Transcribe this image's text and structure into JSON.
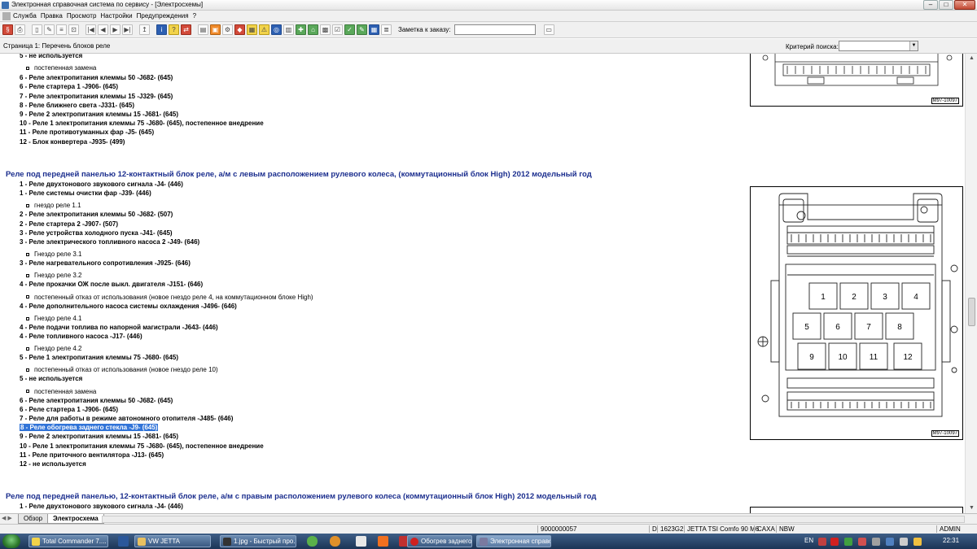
{
  "window": {
    "title": "Электронная справочная система по сервису - [Электросхемы]"
  },
  "menu": [
    "Служба",
    "Правка",
    "Просмотр",
    "Настройки",
    "Предупреждения",
    "?"
  ],
  "toolbar": {
    "note_label": "Заметка к заказу:"
  },
  "crumb": {
    "text": "Страница 1: Перечень блоков реле",
    "criteria_label": "Критерий поиска:"
  },
  "block1_lines": [
    {
      "t": "5 -  не используется",
      "kind": "b"
    },
    {
      "t": "постепенная замена",
      "kind": "sub"
    },
    {
      "t": "6 -  Реле электропитания клеммы 50 -J682- (645)",
      "kind": "b"
    },
    {
      "t": "6 -  Реле стартера 1 -J906- (645)",
      "kind": "b"
    },
    {
      "t": "7 -  Реле электропитания клеммы 15 -J329- (645)",
      "kind": "b"
    },
    {
      "t": "8 -  Реле ближнего света -J331- (645)",
      "kind": "b"
    },
    {
      "t": "9 -  Реле 2 электропитания клеммы 15 -J681- (645)",
      "kind": "b"
    },
    {
      "t": "10 -  Реле 1 электропитания клеммы 75 -J680- (645), постепенное внедрение",
      "kind": "b"
    },
    {
      "t": "11 -  Реле противотуманных фар -J5- (645)",
      "kind": "b"
    },
    {
      "t": "12 -  Блок конвертера -J935- (499)",
      "kind": "b"
    }
  ],
  "heading1": "Реле под передней панелью 12-контактный блок реле, а/м с левым расположением рулевого колеса, (коммутационный блок High) 2012 модельный год",
  "block2_lines": [
    {
      "t": "1 -  Реле двухтонового звукового сигнала -J4- (446)",
      "kind": "b"
    },
    {
      "t": "1 -  Реле системы очистки фар -J39- (446)",
      "kind": "b"
    },
    {
      "t": "гнездо реле 1.1",
      "kind": "sub"
    },
    {
      "t": "2 -  Реле электропитания клеммы 50 -J682- (507)",
      "kind": "b"
    },
    {
      "t": "2 -  Реле стартера 2 -J907- (507)",
      "kind": "b"
    },
    {
      "t": "3 -  Реле устройства холодного пуска -J41- (645)",
      "kind": "b"
    },
    {
      "t": "3 -  Реле электрического топливного насоса 2 -J49- (646)",
      "kind": "b"
    },
    {
      "t": "Гнездо реле 3.1",
      "kind": "sub"
    },
    {
      "t": "3 -  Реле нагревательного сопротивления -J925- (646)",
      "kind": "b"
    },
    {
      "t": "Гнездо реле 3.2",
      "kind": "sub"
    },
    {
      "t": "4 -  Реле прокачки ОЖ после выкл. двигателя -J151- (646)",
      "kind": "b"
    },
    {
      "t": "постепенный отказ от использования (новое гнездо реле 4, на коммутационном блоке High)",
      "kind": "sub"
    },
    {
      "t": "4 -  Реле дополнительного насоса системы охлаждения -J496- (646)",
      "kind": "b"
    },
    {
      "t": "Гнездо реле 4.1",
      "kind": "sub"
    },
    {
      "t": "4 -  Реле подачи топлива по напорной магистрали -J643- (446)",
      "kind": "b"
    },
    {
      "t": "4 -  Реле топливного насоса -J17- (446)",
      "kind": "b"
    },
    {
      "t": "Гнездо реле 4.2",
      "kind": "sub"
    },
    {
      "t": "5 -  Реле 1 электропитания клеммы 75 -J680- (645)",
      "kind": "b"
    },
    {
      "t": "постепенный отказ от использования (новое гнездо реле 10)",
      "kind": "sub"
    },
    {
      "t": "5 -  не используется",
      "kind": "b"
    },
    {
      "t": "постепенная замена",
      "kind": "sub"
    },
    {
      "t": "6 -  Реле электропитания клеммы 50 -J682- (645)",
      "kind": "b"
    },
    {
      "t": "6 -  Реле стартера 1 -J906- (645)",
      "kind": "b"
    },
    {
      "t": "7 -  Реле для работы в режиме автономного отопителя -J485- (646)",
      "kind": "b"
    },
    {
      "t": "8 -  Реле обогрева заднего стекла -J9- (645)",
      "kind": "hl"
    },
    {
      "t": "9 -  Реле 2 электропитания клеммы 15 -J681- (645)",
      "kind": "b"
    },
    {
      "t": "10 -  Реле 1 электропитания клеммы 75 -J680- (645), постепенное внедрение",
      "kind": "b"
    },
    {
      "t": "11 -  Реле приточного вентилятора -J13- (645)",
      "kind": "b"
    },
    {
      "t": "12 -  не используется",
      "kind": "b"
    }
  ],
  "heading2": "Реле под передней панелью, 12-контактный блок реле, а/м с правым расположением рулевого колеса (коммутационный блок High) 2012 модельный год",
  "block3_lines": [
    {
      "t": "1 -  Реле двухтонового звукового сигнала -J4- (446)",
      "kind": "b"
    }
  ],
  "figure_code": "M97-10097",
  "relay_numbers": [
    "1",
    "2",
    "3",
    "4",
    "5",
    "6",
    "7",
    "8",
    "9",
    "10",
    "11",
    "12"
  ],
  "tabs": [
    "Обзор",
    "Электросхема"
  ],
  "status": {
    "code1": "9000000057",
    "d": "D",
    "code2": "1623G2",
    "model": "JETTA TSI Comfo 90 M6",
    "caxa": "CAXA",
    "nbw": "NBW",
    "user": "ADMIN"
  },
  "taskbar": {
    "tasks": [
      "Total Commander 7....",
      "VW JETTA",
      "1.jpg - Быстрый про...",
      "Обогрев заднего ст...",
      "Электронная справо..."
    ],
    "lang": "EN",
    "time": "22:31"
  }
}
